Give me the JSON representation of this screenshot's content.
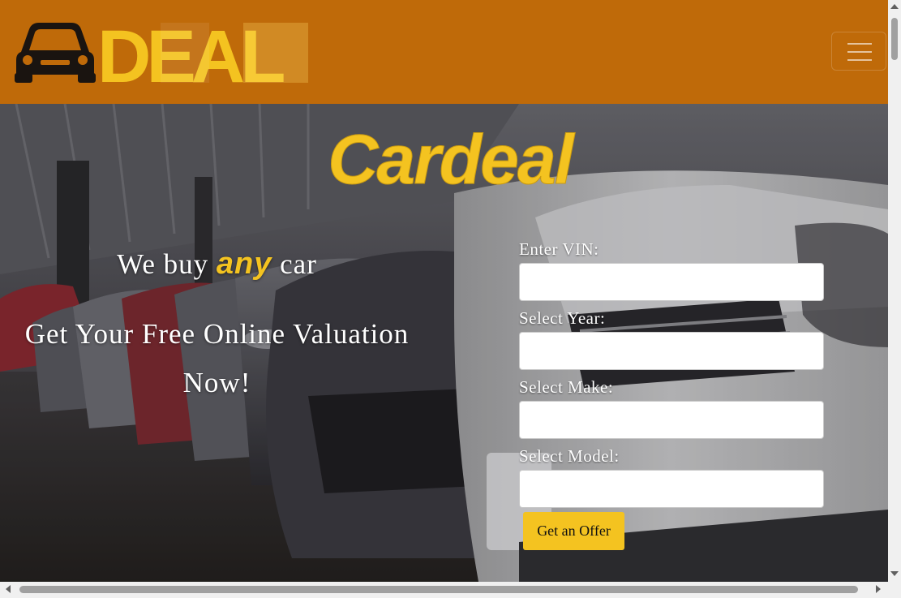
{
  "navbar": {
    "logo_text": "DEAL",
    "background": "#bf6a09",
    "menu_icon": "hamburger-menu-icon"
  },
  "hero": {
    "brand_title": "Cardeal",
    "tagline": {
      "before": "We buy",
      "highlight": "any",
      "after": "car"
    },
    "valuation_line1": "Get Your Free Online Valuation",
    "valuation_line2": "Now!",
    "accent_color": "#f4c320"
  },
  "form": {
    "vin_label": "Enter VIN:",
    "vin_value": "",
    "year_label": "Select Year:",
    "year_value": "",
    "make_label": "Select Make:",
    "make_value": "",
    "model_label": "Select Model:",
    "model_value": "",
    "submit_label": "Get an Offer"
  }
}
